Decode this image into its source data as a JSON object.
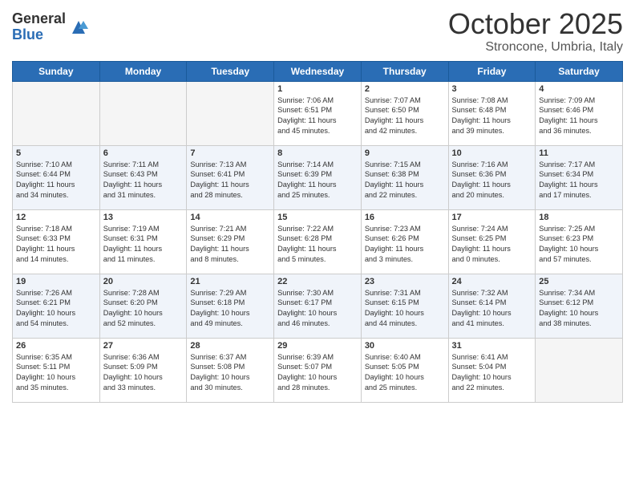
{
  "logo": {
    "general": "General",
    "blue": "Blue"
  },
  "header": {
    "month": "October 2025",
    "location": "Stroncone, Umbria, Italy"
  },
  "weekdays": [
    "Sunday",
    "Monday",
    "Tuesday",
    "Wednesday",
    "Thursday",
    "Friday",
    "Saturday"
  ],
  "weeks": [
    [
      {
        "day": "",
        "info": ""
      },
      {
        "day": "",
        "info": ""
      },
      {
        "day": "",
        "info": ""
      },
      {
        "day": "1",
        "info": "Sunrise: 7:06 AM\nSunset: 6:51 PM\nDaylight: 11 hours\nand 45 minutes."
      },
      {
        "day": "2",
        "info": "Sunrise: 7:07 AM\nSunset: 6:50 PM\nDaylight: 11 hours\nand 42 minutes."
      },
      {
        "day": "3",
        "info": "Sunrise: 7:08 AM\nSunset: 6:48 PM\nDaylight: 11 hours\nand 39 minutes."
      },
      {
        "day": "4",
        "info": "Sunrise: 7:09 AM\nSunset: 6:46 PM\nDaylight: 11 hours\nand 36 minutes."
      }
    ],
    [
      {
        "day": "5",
        "info": "Sunrise: 7:10 AM\nSunset: 6:44 PM\nDaylight: 11 hours\nand 34 minutes."
      },
      {
        "day": "6",
        "info": "Sunrise: 7:11 AM\nSunset: 6:43 PM\nDaylight: 11 hours\nand 31 minutes."
      },
      {
        "day": "7",
        "info": "Sunrise: 7:13 AM\nSunset: 6:41 PM\nDaylight: 11 hours\nand 28 minutes."
      },
      {
        "day": "8",
        "info": "Sunrise: 7:14 AM\nSunset: 6:39 PM\nDaylight: 11 hours\nand 25 minutes."
      },
      {
        "day": "9",
        "info": "Sunrise: 7:15 AM\nSunset: 6:38 PM\nDaylight: 11 hours\nand 22 minutes."
      },
      {
        "day": "10",
        "info": "Sunrise: 7:16 AM\nSunset: 6:36 PM\nDaylight: 11 hours\nand 20 minutes."
      },
      {
        "day": "11",
        "info": "Sunrise: 7:17 AM\nSunset: 6:34 PM\nDaylight: 11 hours\nand 17 minutes."
      }
    ],
    [
      {
        "day": "12",
        "info": "Sunrise: 7:18 AM\nSunset: 6:33 PM\nDaylight: 11 hours\nand 14 minutes."
      },
      {
        "day": "13",
        "info": "Sunrise: 7:19 AM\nSunset: 6:31 PM\nDaylight: 11 hours\nand 11 minutes."
      },
      {
        "day": "14",
        "info": "Sunrise: 7:21 AM\nSunset: 6:29 PM\nDaylight: 11 hours\nand 8 minutes."
      },
      {
        "day": "15",
        "info": "Sunrise: 7:22 AM\nSunset: 6:28 PM\nDaylight: 11 hours\nand 5 minutes."
      },
      {
        "day": "16",
        "info": "Sunrise: 7:23 AM\nSunset: 6:26 PM\nDaylight: 11 hours\nand 3 minutes."
      },
      {
        "day": "17",
        "info": "Sunrise: 7:24 AM\nSunset: 6:25 PM\nDaylight: 11 hours\nand 0 minutes."
      },
      {
        "day": "18",
        "info": "Sunrise: 7:25 AM\nSunset: 6:23 PM\nDaylight: 10 hours\nand 57 minutes."
      }
    ],
    [
      {
        "day": "19",
        "info": "Sunrise: 7:26 AM\nSunset: 6:21 PM\nDaylight: 10 hours\nand 54 minutes."
      },
      {
        "day": "20",
        "info": "Sunrise: 7:28 AM\nSunset: 6:20 PM\nDaylight: 10 hours\nand 52 minutes."
      },
      {
        "day": "21",
        "info": "Sunrise: 7:29 AM\nSunset: 6:18 PM\nDaylight: 10 hours\nand 49 minutes."
      },
      {
        "day": "22",
        "info": "Sunrise: 7:30 AM\nSunset: 6:17 PM\nDaylight: 10 hours\nand 46 minutes."
      },
      {
        "day": "23",
        "info": "Sunrise: 7:31 AM\nSunset: 6:15 PM\nDaylight: 10 hours\nand 44 minutes."
      },
      {
        "day": "24",
        "info": "Sunrise: 7:32 AM\nSunset: 6:14 PM\nDaylight: 10 hours\nand 41 minutes."
      },
      {
        "day": "25",
        "info": "Sunrise: 7:34 AM\nSunset: 6:12 PM\nDaylight: 10 hours\nand 38 minutes."
      }
    ],
    [
      {
        "day": "26",
        "info": "Sunrise: 6:35 AM\nSunset: 5:11 PM\nDaylight: 10 hours\nand 35 minutes."
      },
      {
        "day": "27",
        "info": "Sunrise: 6:36 AM\nSunset: 5:09 PM\nDaylight: 10 hours\nand 33 minutes."
      },
      {
        "day": "28",
        "info": "Sunrise: 6:37 AM\nSunset: 5:08 PM\nDaylight: 10 hours\nand 30 minutes."
      },
      {
        "day": "29",
        "info": "Sunrise: 6:39 AM\nSunset: 5:07 PM\nDaylight: 10 hours\nand 28 minutes."
      },
      {
        "day": "30",
        "info": "Sunrise: 6:40 AM\nSunset: 5:05 PM\nDaylight: 10 hours\nand 25 minutes."
      },
      {
        "day": "31",
        "info": "Sunrise: 6:41 AM\nSunset: 5:04 PM\nDaylight: 10 hours\nand 22 minutes."
      },
      {
        "day": "",
        "info": ""
      }
    ]
  ]
}
